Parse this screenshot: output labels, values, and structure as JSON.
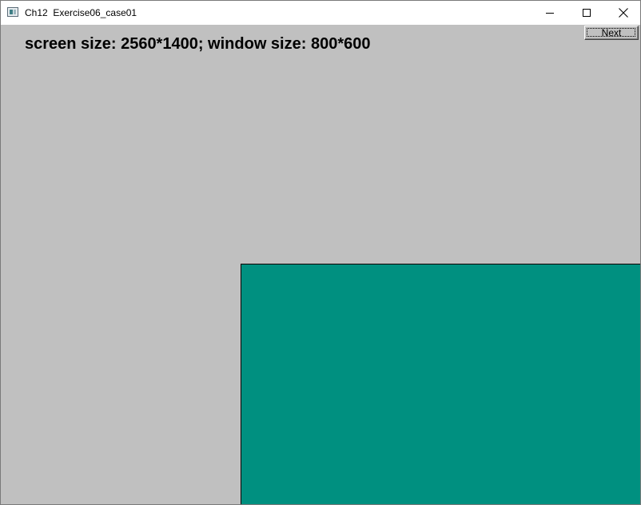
{
  "window": {
    "title": "Ch12  Exercise06_case01",
    "icon": "app-window-icon"
  },
  "caption_buttons": {
    "minimize": "minimize-icon",
    "maximize": "maximize-icon",
    "close": "close-icon"
  },
  "content": {
    "info_text": "screen size: 2560*1400; window size: 800*600",
    "next_label": "Next",
    "background_color": "#c0c0c0",
    "rectangle_color": "#009080"
  }
}
